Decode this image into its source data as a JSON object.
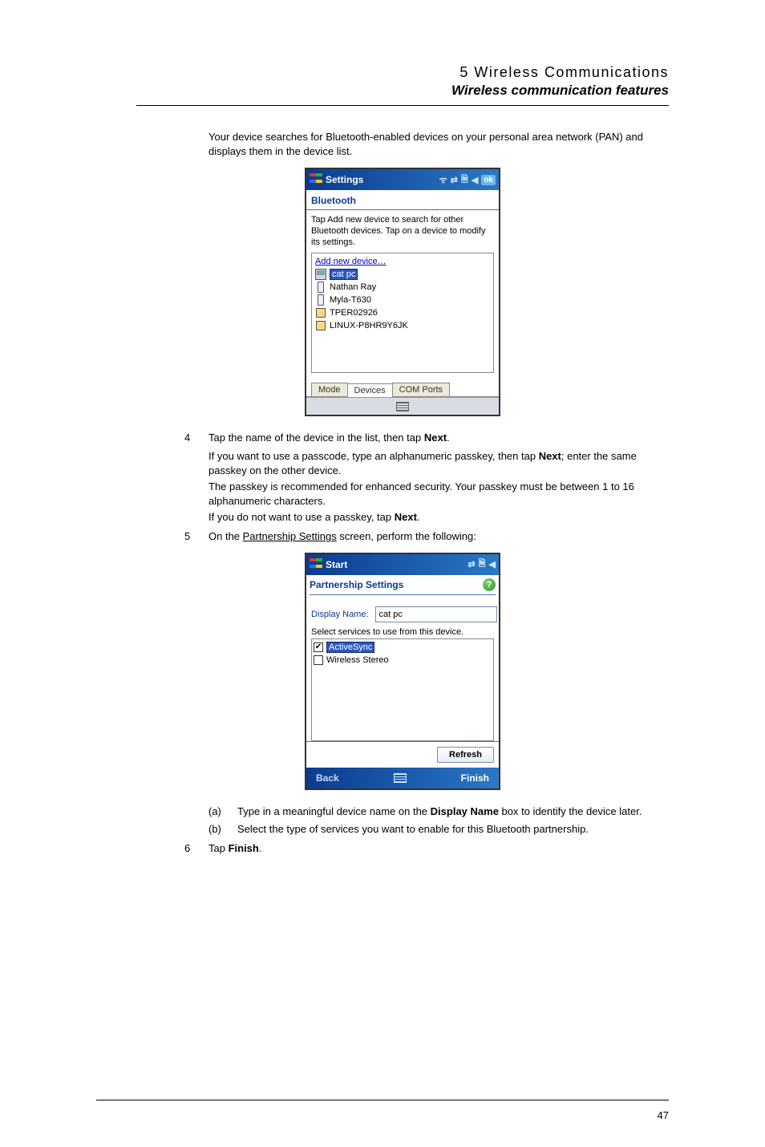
{
  "header": {
    "chapter": "5 Wireless Communications",
    "subtitle": "Wireless communication features"
  },
  "intro": "Your device searches for Bluetooth-enabled devices on your personal area network (PAN) and displays them in the device list.",
  "shot1": {
    "titlebar": "Settings",
    "ok": "ok",
    "subtitle": "Bluetooth",
    "hint": "Tap Add new device to search for other Bluetooth devices. Tap on a device to modify its settings.",
    "devices": {
      "add": "Add new device…",
      "d0": "cat pc",
      "d1": "Nathan Ray",
      "d2": "Myla-T630",
      "d3": "TPER02926",
      "d4": "LINUX-P8HR9Y6JK"
    },
    "tabs": {
      "mode": "Mode",
      "devices": "Devices",
      "com": "COM Ports"
    }
  },
  "step4": {
    "idx": "4",
    "line_a": "Tap the name of the device in the list, then tap ",
    "next": "Next",
    "period": ".",
    "line_b_a": "If you want to use a passcode, type an alphanumeric passkey, then tap ",
    "line_b_c": "; enter the same passkey on the other device.",
    "line_c": "The passkey is recommended for enhanced security. Your passkey must be between 1 to 16 alphanumeric characters.",
    "line_d_a": "If you do not want to use a passkey, tap "
  },
  "step5": {
    "idx": "5",
    "pre": "On the ",
    "link": "Partnership Settings",
    "post": " screen, perform the following:"
  },
  "shot2": {
    "titlebar": "Start",
    "subtitle": "Partnership Settings",
    "display_label": "Display Name:",
    "display_value": "cat pc",
    "hint": "Select services to use from this device.",
    "svc0": "ActiveSync",
    "svc1": "Wireless Stereo",
    "refresh": "Refresh",
    "back": "Back",
    "finish": "Finish"
  },
  "sub_a": {
    "key": "(a)",
    "pre": "Type in a meaningful device name on the ",
    "bold": "Display Name",
    "post": " box to identify the device later."
  },
  "sub_b": {
    "key": "(b)",
    "text": "Select the type of services you want to enable for this Bluetooth partnership."
  },
  "step6": {
    "idx": "6",
    "pre": "Tap ",
    "bold": "Finish",
    "post": "."
  },
  "page_number": "47"
}
